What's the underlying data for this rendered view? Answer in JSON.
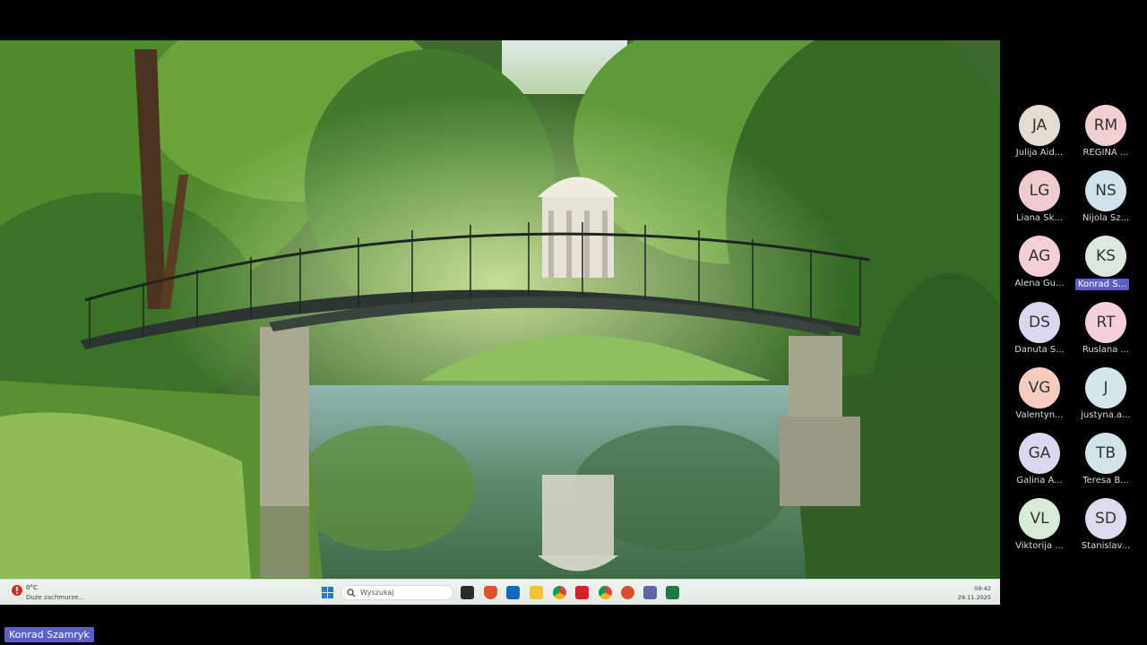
{
  "taskbar": {
    "weather_temp": "0°C",
    "weather_desc": "Duże zachmurze...",
    "search_placeholder": "Wyszukaj",
    "time": "09:42",
    "date": "29.11.2025",
    "apps": [
      "file-explorer-icon",
      "brave-icon",
      "outlook-icon",
      "folder-icon",
      "chrome-icon",
      "acrobat-icon",
      "chrome-profile-icon",
      "office-icon",
      "teams-icon",
      "excel-icon"
    ]
  },
  "participants": [
    {
      "initials": "JA",
      "name": "Julija Aid...",
      "color": "#e4dbd2"
    },
    {
      "initials": "RM",
      "name": "REGINA ...",
      "color": "#f2cfd2"
    },
    {
      "initials": "LG",
      "name": "Liana Sk...",
      "color": "#f0ccd0"
    },
    {
      "initials": "NS",
      "name": "Nijola Sz...",
      "color": "#cfe4ea"
    },
    {
      "initials": "AG",
      "name": "Alena Gu...",
      "color": "#f2d0d6"
    },
    {
      "initials": "KS",
      "name": "Konrad S...",
      "color": "#dde8dc",
      "active": true
    },
    {
      "initials": "DS",
      "name": "Danuta S...",
      "color": "#d8d8ef"
    },
    {
      "initials": "RT",
      "name": "Ruslana ...",
      "color": "#f6d0d8"
    },
    {
      "initials": "VG",
      "name": "Valentyn...",
      "color": "#f6ccc0"
    },
    {
      "initials": "J",
      "name": "justyna.a...",
      "color": "#d4e6ea"
    },
    {
      "initials": "GA",
      "name": "Galina A...",
      "color": "#d8d8ef"
    },
    {
      "initials": "TB",
      "name": "Teresa B...",
      "color": "#d2e4e8"
    },
    {
      "initials": "VL",
      "name": "Viktorija ...",
      "color": "#d8ead8"
    },
    {
      "initials": "SD",
      "name": "Stanislav...",
      "color": "#dcdcee"
    }
  ],
  "speaker_name": "Konrad Szamryk"
}
